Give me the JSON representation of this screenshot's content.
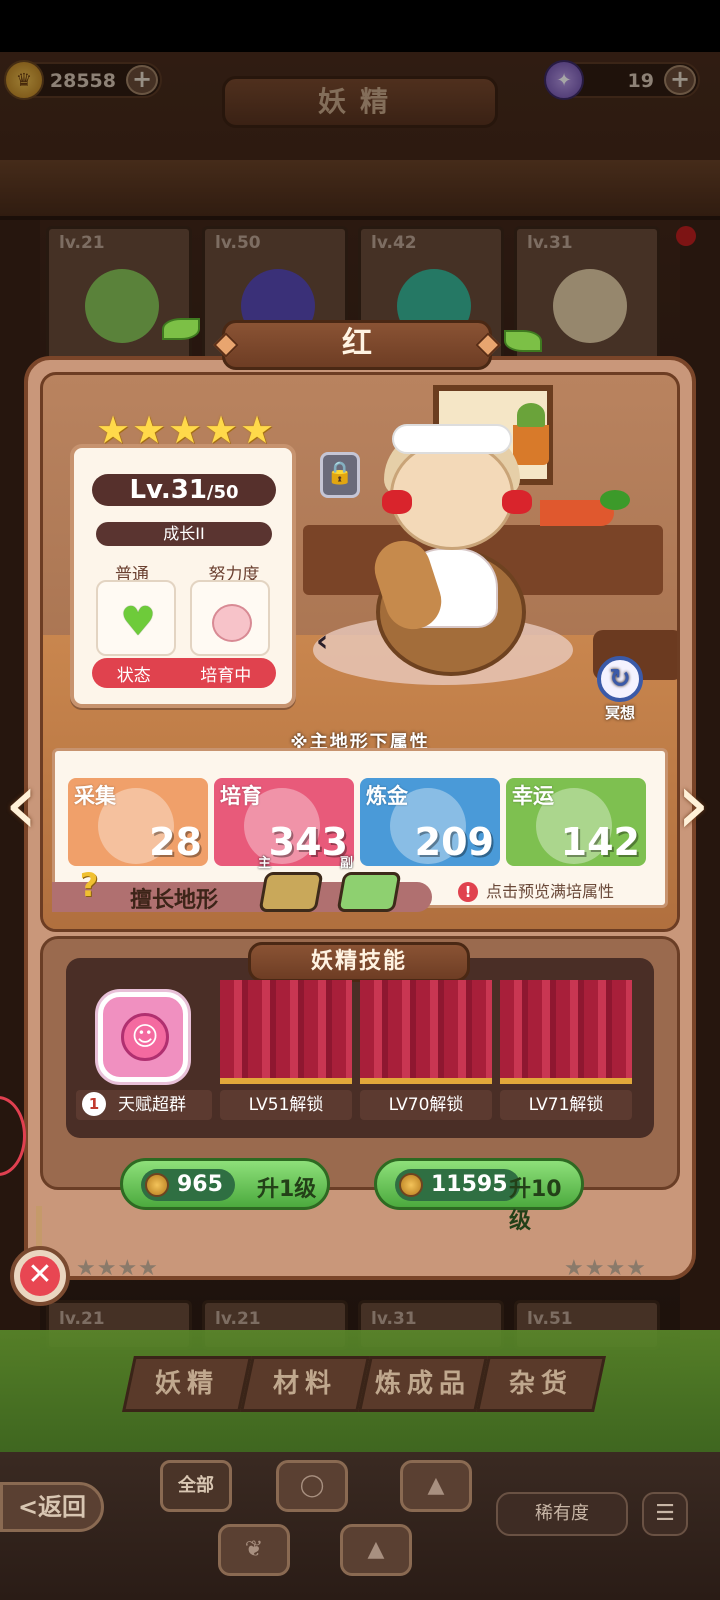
{
  "currency": {
    "coins": "28558",
    "gems": "19",
    "plus": "+"
  },
  "screen_title": "妖精",
  "background_cards": [
    {
      "lv": "lv.21"
    },
    {
      "lv": "lv.50"
    },
    {
      "lv": "lv.42"
    },
    {
      "lv": "lv.31"
    }
  ],
  "lower_cards": [
    {
      "lv": "lv.21"
    },
    {
      "lv": "lv.21"
    },
    {
      "lv": "lv.31"
    },
    {
      "lv": "lv.51"
    }
  ],
  "fairy": {
    "name": "红",
    "stars": 5,
    "level": "Lv.31",
    "level_max": "/50",
    "growth": "成长II",
    "mood_label": "普通",
    "effort_label": "努力度",
    "state_label": "状态",
    "state_value": "培育中"
  },
  "meditate_label": "冥想",
  "attributes": {
    "heading": "※主地形下属性",
    "items": [
      {
        "label": "采集",
        "value": "28",
        "color": "#f0a06a"
      },
      {
        "label": "培育",
        "value": "343",
        "color": "#e85a7a"
      },
      {
        "label": "炼金",
        "value": "209",
        "color": "#4a9ad8"
      },
      {
        "label": "幸运",
        "value": "142",
        "color": "#7ec050"
      }
    ],
    "terrain_label": "擅长地形",
    "main_tag": "主",
    "sub_tag": "副",
    "preview_hint": "点击预览满培属性"
  },
  "skills": {
    "title": "妖精技能",
    "slot1_index": "1",
    "slot1_name": "天赋超群",
    "locked": [
      "LV51解锁",
      "LV70解锁",
      "LV71解锁"
    ]
  },
  "upgrade": {
    "cost1": "965",
    "label1": "升1级",
    "cost10": "11595",
    "label10": "升10级"
  },
  "bottom_tabs": [
    "妖精",
    "材料",
    "炼成品",
    "杂货"
  ],
  "bottom_bar": {
    "back": "<返回",
    "all": "全部",
    "rarity": "稀有度"
  },
  "colors": {
    "accent_red": "#e0424e",
    "panel": "#c9977a",
    "green_button": "#4caa3e"
  }
}
